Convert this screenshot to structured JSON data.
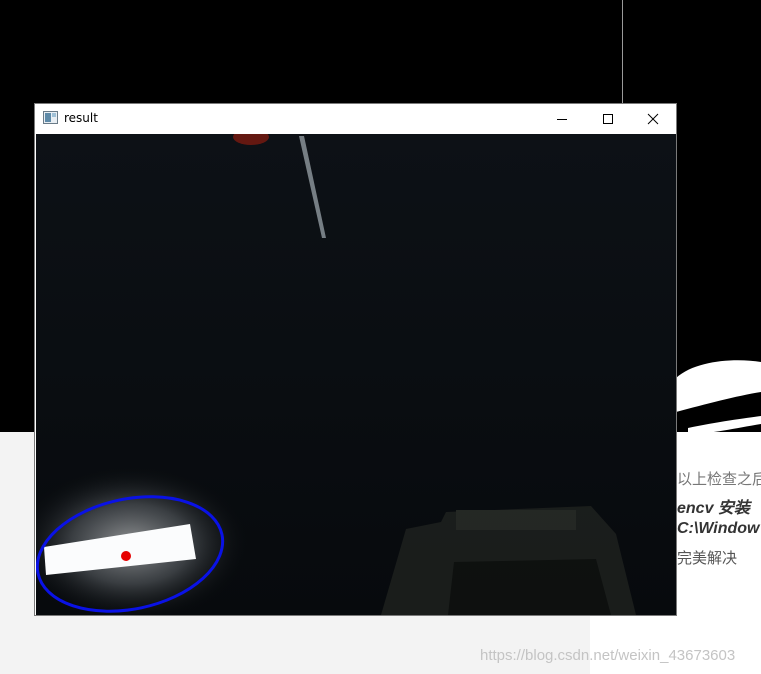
{
  "window": {
    "title": "result",
    "icon": "image-window-icon",
    "controls": {
      "minimize": "minimize-icon",
      "maximize": "maximize-icon",
      "close": "close-icon"
    }
  },
  "background": {
    "blog_lines": [
      "以上检查之后",
      "encv 安装",
      "C:\\Window",
      "完美解决"
    ],
    "watermark": "https://blog.csdn.net/weixin_43673603"
  },
  "colors": {
    "ellipse": "#0a12e6",
    "center_dot": "#e60000",
    "frame_bg": "#070a0d"
  }
}
